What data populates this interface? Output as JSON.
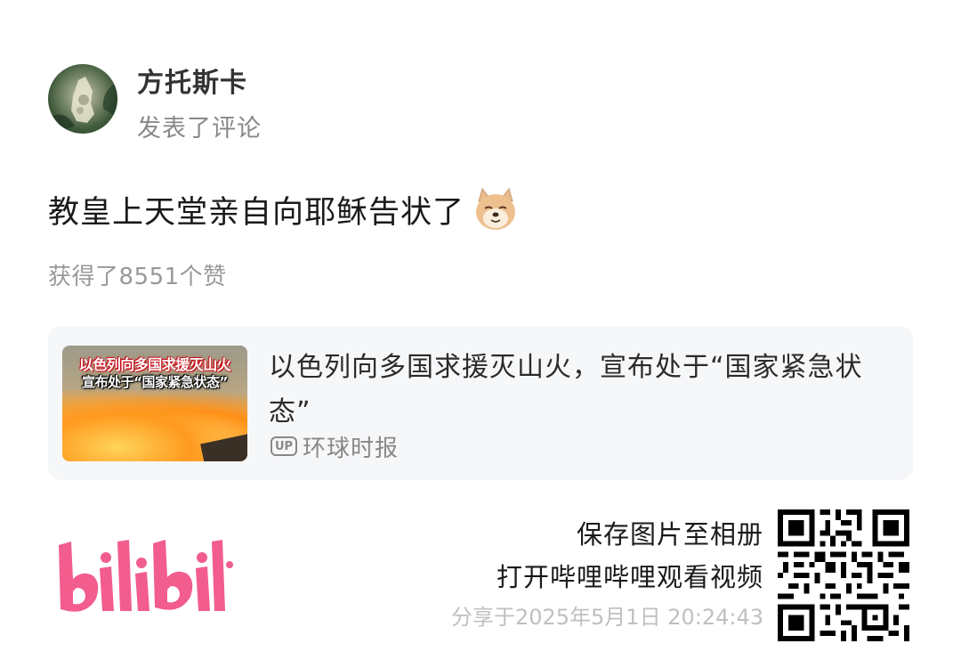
{
  "user": {
    "name": "方托斯卡",
    "action": "发表了评论"
  },
  "comment": {
    "text": "教皇上天堂亲自向耶稣告状了",
    "emoji": "doge-icon"
  },
  "likes": "获得了8551个赞",
  "video_card": {
    "thumbnail_caption_line1": "以色列向多国求援灭山火",
    "thumbnail_caption_line2": "宣布处于“国家紧急状态”",
    "title": "以色列向多国求援灭山火，宣布处于“国家紧急状态”",
    "up_badge": "UP",
    "author": "环球时报"
  },
  "footer": {
    "brand": "bilibili",
    "save_text": "保存图片至相册",
    "open_text": "打开哔哩哔哩观看视频",
    "share_time": "分享于2025年5月1日 20:24:43"
  },
  "colors": {
    "brand_pink": "#f25d8e",
    "muted_text": "#888888",
    "card_bg": "#f6f7f9"
  }
}
